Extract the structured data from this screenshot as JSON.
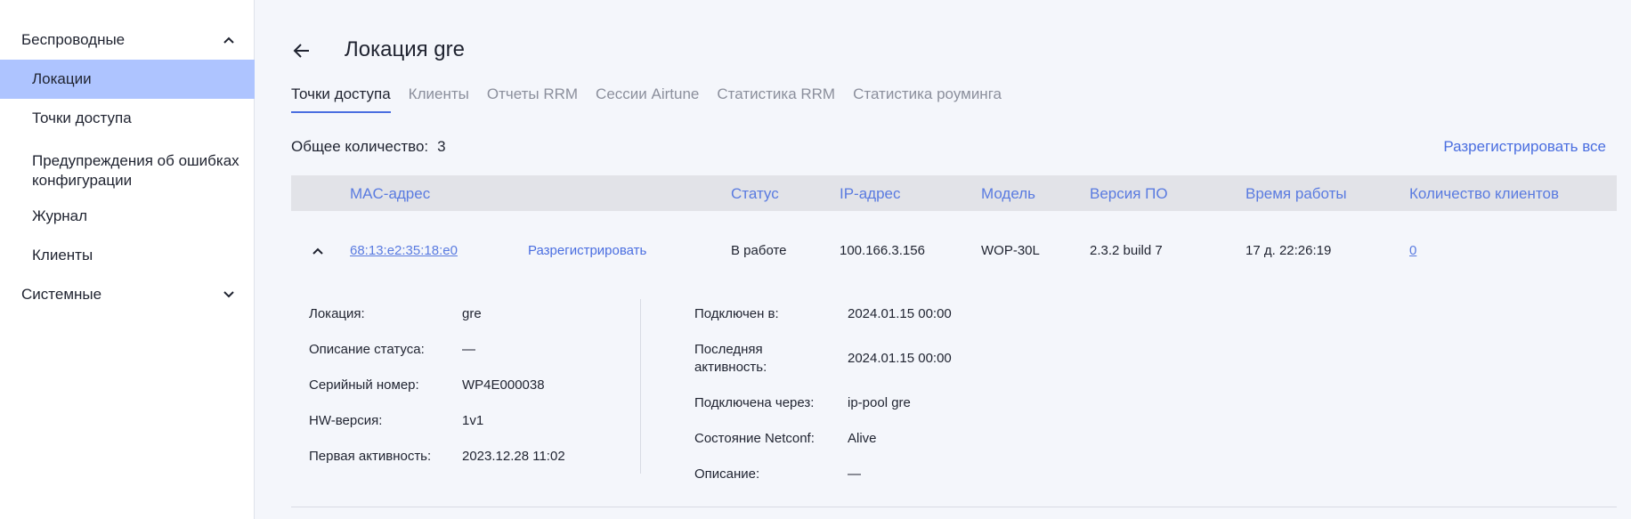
{
  "sidebar": {
    "wireless_label": "Беспроводные",
    "system_label": "Системные",
    "items": [
      {
        "label": "Локации"
      },
      {
        "label": "Точки доступа"
      },
      {
        "label": "Предупреждения об ошибках конфигурации"
      },
      {
        "label": "Журнал"
      },
      {
        "label": "Клиенты"
      }
    ]
  },
  "header": {
    "title": "Локация gre"
  },
  "tabs": [
    {
      "label": "Точки доступа"
    },
    {
      "label": "Клиенты"
    },
    {
      "label": "Отчеты RRM"
    },
    {
      "label": "Сессии Airtune"
    },
    {
      "label": "Статистика RRM"
    },
    {
      "label": "Статистика роуминга"
    }
  ],
  "summary": {
    "total_label": "Общее количество:",
    "total_value": "3",
    "unregister_all": "Разрегистрировать все"
  },
  "table": {
    "columns": [
      "MAC-адрес",
      "Статус",
      "IP-адрес",
      "Модель",
      "Версия ПО",
      "Время работы",
      "Количество клиентов"
    ],
    "row": {
      "mac": "68:13:e2:35:18:e0",
      "unregister": "Разрегистрировать",
      "status": "В работе",
      "ip": "100.166.3.156",
      "model": "WOP-30L",
      "firmware": "2.3.2 build 7",
      "uptime": "17 д. 22:26:19",
      "clients": "0"
    }
  },
  "details": {
    "left": [
      {
        "label": "Локация:",
        "value": "gre"
      },
      {
        "label": "Описание статуса:",
        "value": "—"
      },
      {
        "label": "Серийный номер:",
        "value": "WP4E000038"
      },
      {
        "label": "HW-версия:",
        "value": "1v1"
      },
      {
        "label": "Первая активность:",
        "value": "2023.12.28 11:02"
      }
    ],
    "right": [
      {
        "label": "Подключен в:",
        "value": "2024.01.15 00:00"
      },
      {
        "label": "Последняя активность:",
        "value": "2024.01.15 00:00"
      },
      {
        "label": "Подключена через:",
        "value": "ip-pool gre"
      },
      {
        "label": "Состояние Netconf:",
        "value": "Alive"
      },
      {
        "label": "Описание:",
        "value": "—"
      }
    ]
  }
}
